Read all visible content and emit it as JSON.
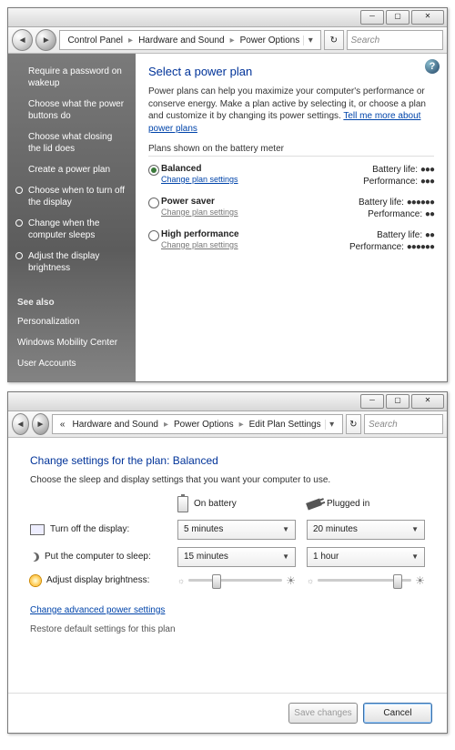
{
  "win1": {
    "breadcrumb": [
      "Control Panel",
      "Hardware and Sound",
      "Power Options"
    ],
    "search_placeholder": "Search",
    "sidebar_tasks": [
      "Require a password on wakeup",
      "Choose what the power buttons do",
      "Choose what closing the lid does",
      "Create a power plan",
      "Choose when to turn off the display",
      "Change when the computer sleeps",
      "Adjust the display brightness"
    ],
    "see_also_label": "See also",
    "see_also": [
      "Personalization",
      "Windows Mobility Center",
      "User Accounts"
    ],
    "title": "Select a power plan",
    "desc_a": "Power plans can help you maximize your computer's performance or conserve energy. Make a plan active by selecting it, or choose a plan and customize it by changing its power settings. ",
    "desc_link": "Tell me more about power plans",
    "list_head": "Plans shown on the battery meter",
    "plans": [
      {
        "name": "Balanced",
        "link": "Change plan settings",
        "selected": true,
        "batt": "●●●",
        "perf": "●●●"
      },
      {
        "name": "Power saver",
        "link": "Change plan settings",
        "selected": false,
        "batt": "●●●●●●",
        "perf": "●●"
      },
      {
        "name": "High performance",
        "link": "Change plan settings",
        "selected": false,
        "batt": "●●",
        "perf": "●●●●●●"
      }
    ],
    "batt_label": "Battery life:",
    "perf_label": "Performance:"
  },
  "win2": {
    "breadcrumb": [
      "Hardware and Sound",
      "Power Options",
      "Edit Plan Settings"
    ],
    "bc_prefix": "«",
    "search_placeholder": "Search",
    "title": "Change settings for the plan: Balanced",
    "desc": "Choose the sleep and display settings that you want your computer to use.",
    "col_battery": "On battery",
    "col_plugged": "Plugged in",
    "row_display": "Turn off the display:",
    "row_sleep": "Put the computer to sleep:",
    "row_bright": "Adjust display brightness:",
    "val_display_batt": "5 minutes",
    "val_display_plug": "20 minutes",
    "val_sleep_batt": "15 minutes",
    "val_sleep_plug": "1 hour",
    "adv_link": "Change advanced power settings",
    "restore_link": "Restore default settings for this plan",
    "btn_save": "Save changes",
    "btn_cancel": "Cancel"
  }
}
